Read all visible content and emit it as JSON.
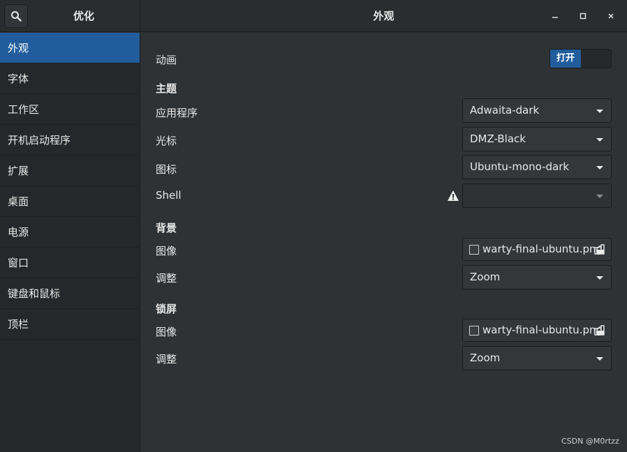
{
  "sidebar_title": "优化",
  "page_title": "外观",
  "window_controls": {
    "minimize": "–",
    "maximize": "□",
    "close": "×"
  },
  "sidebar": {
    "items": [
      {
        "label": "外观",
        "active": true
      },
      {
        "label": "字体",
        "active": false
      },
      {
        "label": "工作区",
        "active": false
      },
      {
        "label": "开机启动程序",
        "active": false
      },
      {
        "label": "扩展",
        "active": false
      },
      {
        "label": "桌面",
        "active": false
      },
      {
        "label": "电源",
        "active": false
      },
      {
        "label": "窗口",
        "active": false
      },
      {
        "label": "键盘和鼠标",
        "active": false
      },
      {
        "label": "顶栏",
        "active": false
      }
    ]
  },
  "animation": {
    "label": "动画",
    "switch_on_label": "打开",
    "state": "on"
  },
  "themes": {
    "section": "主题",
    "applications_label": "应用程序",
    "applications_value": "Adwaita-dark",
    "cursor_label": "光标",
    "cursor_value": "DMZ-Black",
    "icons_label": "图标",
    "icons_value": "Ubuntu-mono-dark",
    "shell_label": "Shell",
    "shell_value": "",
    "shell_icon": "warning-icon"
  },
  "background": {
    "section": "背景",
    "image_label": "图像",
    "image_value": "warty-final-ubuntu.png",
    "adjust_label": "调整",
    "adjust_value": "Zoom"
  },
  "lockscreen": {
    "section": "锁屏",
    "image_label": "图像",
    "image_value": "warty-final-ubuntu.png",
    "adjust_label": "调整",
    "adjust_value": "Zoom"
  },
  "watermark": "CSDN @M0rtzz",
  "colors": {
    "accent": "#215d9c",
    "background": "#2f3235",
    "sidebar": "#25272a"
  }
}
